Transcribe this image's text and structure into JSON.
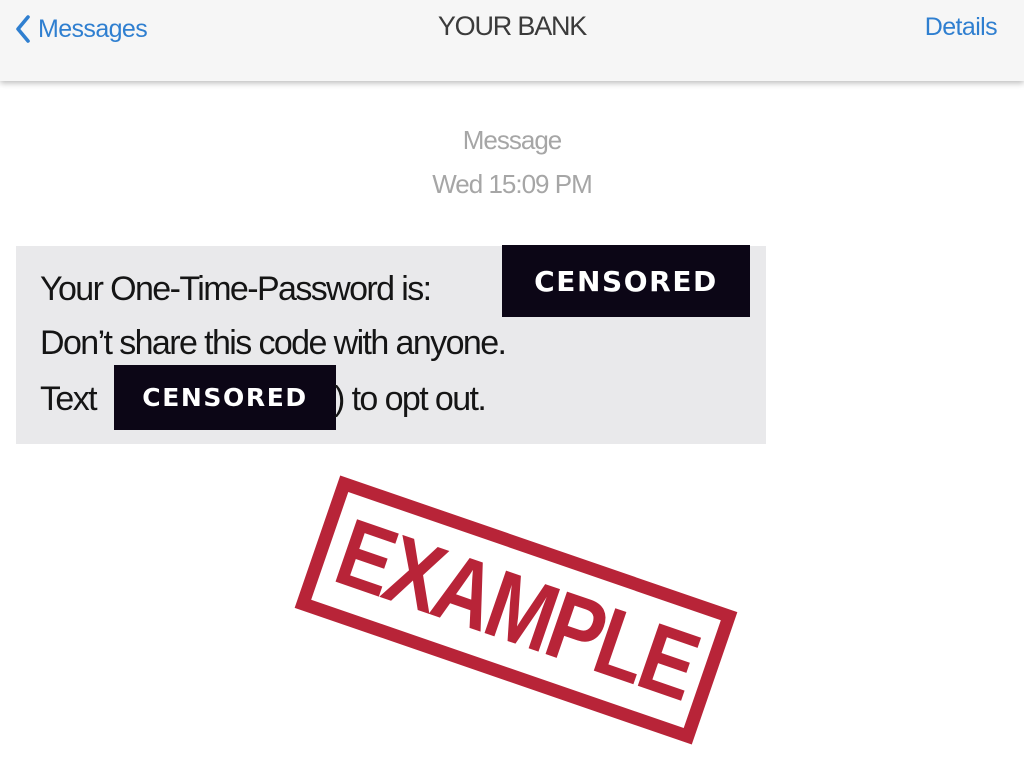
{
  "nav": {
    "back_label": "Messages",
    "title": "YOUR BANK",
    "details_label": "Details",
    "accent_color": "#2f7fd0"
  },
  "message": {
    "header": "Message",
    "timestamp": "Wed 15:09 PM",
    "line1": "Your One-Time-Password is:",
    "line2": "Don’t share this code with anyone.",
    "line3_prefix": "Text",
    "line3_suffix": ") to opt out.",
    "redaction_label": "CENSORED",
    "bubble_color": "#e9e9eb"
  },
  "stamp": {
    "text": "EXAMPLE",
    "color": "#b3142a"
  },
  "icons": {
    "back": "chevron-left-icon"
  }
}
